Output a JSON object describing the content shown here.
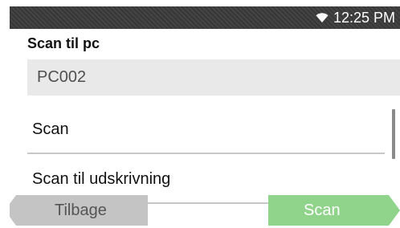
{
  "status_bar": {
    "time": "12:25 PM",
    "wifi_icon": "wifi-icon"
  },
  "screen": {
    "title": "Scan til pc",
    "selected_target": "PC002"
  },
  "menu": {
    "items": [
      {
        "label": "Scan"
      },
      {
        "label": "Scan til udskrivning"
      }
    ]
  },
  "footer": {
    "back_label": "Tilbage",
    "scan_label": "Scan",
    "scan_icon": "play-arrow-icon"
  },
  "colors": {
    "status_bar": "#3a3a3a",
    "scan_button": "#8fd48a",
    "back_button": "#c4c4c4",
    "selected_row": "#e9e9e9"
  }
}
